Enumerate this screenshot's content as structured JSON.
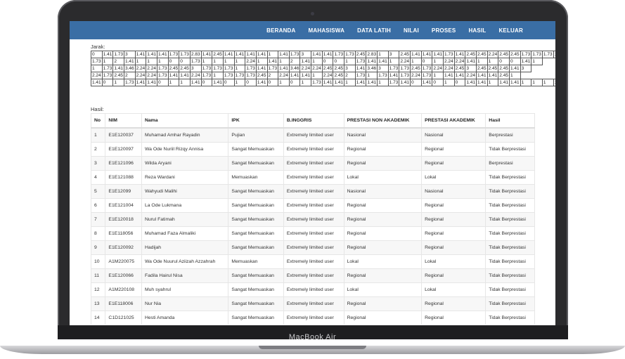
{
  "device": {
    "brand_label": "MacBook Air"
  },
  "nav": {
    "items": [
      "BERANDA",
      "MAHASISWA",
      "DATA LATIH",
      "NILAI",
      "PROSES",
      "HASIL",
      "KELUAR"
    ]
  },
  "jarak": {
    "label": "Jarak:",
    "rows": [
      [
        "0",
        "1.41",
        "1.73",
        "3",
        "1.41",
        "1.41",
        "1.41",
        "1.73",
        "1.73",
        "2.83",
        "1.41",
        "2.45",
        "1.41",
        "1.41",
        "1.41",
        "1.41",
        "1",
        "1.41",
        "1.73",
        "3",
        "1.41",
        "1.41",
        "1.73",
        "1.73",
        "2.45",
        "2.83",
        "1",
        "3",
        "2.45",
        "1.41",
        "1.41",
        "1.41",
        "1.73",
        "1.41",
        "2.45",
        "2.45",
        "2.24",
        "2.45",
        "2.45",
        "1.73",
        "1.73",
        "1.73",
        "1",
        "2"
      ],
      [
        "1.73",
        "1",
        "2",
        "1.41",
        "1",
        "1",
        "1",
        "0",
        "0",
        "1.73",
        "1",
        "1",
        "1",
        "1",
        "2.24",
        "1",
        "1.41",
        "1",
        "2",
        "1.41",
        "1",
        "0",
        "0",
        "1",
        "1.73",
        "1.41",
        "1.41",
        "1",
        "2.24",
        "1",
        "0",
        "1",
        "2.24",
        "2.24",
        "1.41",
        "1",
        "1",
        "0",
        "0",
        "1.41",
        "1"
      ],
      [
        "1",
        "1.73",
        "1.41",
        "3.46",
        "2.24",
        "2.24",
        "1.73",
        "2.45",
        "2.45",
        "3",
        "1.73",
        "1.73",
        "1.73",
        "1",
        "1.73",
        "1.41",
        "1.73",
        "1.41",
        "3.46",
        "2.24",
        "2.24",
        "2.45",
        "2.45",
        "3",
        "1.41",
        "3.46",
        "3",
        "1.73",
        "1.73",
        "2.45",
        "1.73",
        "2.24",
        "2.24",
        "2.45",
        "3",
        "2.45",
        "2.45",
        "2.45",
        "1.41",
        "3"
      ],
      [
        "2.24",
        "1.73",
        "2.45",
        "2",
        "2.24",
        "2.24",
        "1.73",
        "1.41",
        "1.41",
        "2.24",
        "1.73",
        "1",
        "1.73",
        "1.73",
        "1.73",
        "2.45",
        "2",
        "2.24",
        "1.41",
        "1.41",
        "1",
        "2.24",
        "2.45",
        "2",
        "1.73",
        "1",
        "1.73",
        "1.41",
        "1.73",
        "2.24",
        "1.73",
        "1",
        "1.41",
        "1.41",
        "2.24",
        "1.41",
        "1.41",
        "2.45",
        "1"
      ],
      [
        "1.41",
        "0",
        "1",
        "1.73",
        "1.41",
        "1.41",
        "0",
        "1",
        "1",
        "1.41",
        "0",
        "1.41",
        "0",
        "1",
        "0",
        "1.41",
        "0",
        "1",
        "0",
        "1",
        "1.73",
        "1.41",
        "1.41",
        "1",
        "1.41",
        "1.41",
        "1",
        "1.73",
        "1.41",
        "0",
        "1.41",
        "0",
        "1",
        "0",
        "1.41",
        "1.41",
        "1",
        "1.41",
        "1.41",
        "1",
        "1",
        "1",
        "1",
        "1"
      ]
    ]
  },
  "hasil": {
    "label": "Hasil:",
    "headers": [
      "No",
      "NIM",
      "Nama",
      "IPK",
      "B.INGGRIS",
      "PRESTASI NON AKADEMIK",
      "PRESTASI AKADEMIK",
      "Hasil"
    ],
    "rows": [
      [
        "1",
        "E1E120037",
        "Muhamad Amhar Rayadin",
        "Pujian",
        "Extremely limited user",
        "Nasional",
        "Nasional",
        "Berprestasi"
      ],
      [
        "2",
        "E1E120097",
        "Wa Ode Nuriil Rizqy Annisa",
        "Sangat Memuaskan",
        "Extremely limited user",
        "Regional",
        "Regional",
        "Tidak Berprestasi"
      ],
      [
        "3",
        "E1E121096",
        "Wilda Aryani",
        "Sangat Memuaskan",
        "Extremely limited user",
        "Regional",
        "Regional",
        "Berprestasi"
      ],
      [
        "4",
        "E1E121088",
        "Reza Wardani",
        "Memuaskan",
        "Extremely limited user",
        "Lokal",
        "Lokal",
        "Tidak Berprestasi"
      ],
      [
        "5",
        "E1E12099",
        "Wahyudi Malihi",
        "Sangat Memuaskan",
        "Extremely limited user",
        "Nasional",
        "Nasional",
        "Tidak Berprestasi"
      ],
      [
        "6",
        "E1E121004",
        "La Ode Lukmana",
        "Sangat Memuaskan",
        "Extremely limited user",
        "Regional",
        "Regional",
        "Tidak Berprestasi"
      ],
      [
        "7",
        "E1E120018",
        "Nurul Fatimah",
        "Sangat Memuaskan",
        "Extremely limited user",
        "Regional",
        "Regional",
        "Tidak Berprestasi"
      ],
      [
        "8",
        "E1E118056",
        "Muhamad Faza Almaliki",
        "Sangat Memuaskan",
        "Extremely limited user",
        "Regional",
        "Regional",
        "Tidak Berprestasi"
      ],
      [
        "9",
        "E1E120092",
        "Hadijah",
        "Sangat Memuaskan",
        "Extremely limited user",
        "Regional",
        "Regional",
        "Tidak Berprestasi"
      ],
      [
        "10",
        "A1M220075",
        "Wa Ode Nuurul Aziizah Azzahrah",
        "Memuaskan",
        "Extremely limited user",
        "Lokal",
        "Lokal",
        "Tidak Berprestasi"
      ],
      [
        "11",
        "E1E120066",
        "Fadila Hairul Nisa",
        "Sangat Memuaskan",
        "Extremely limited user",
        "Regional",
        "Regional",
        "Tidak Berprestasi"
      ],
      [
        "12",
        "A1M220108",
        "Muh syahrul",
        "Sangat Memuaskan",
        "Extremely limited user",
        "Lokal",
        "Lokal",
        "Tidak Berprestasi"
      ],
      [
        "13",
        "E1E118006",
        "Nur Nia",
        "Sangat Memuaskan",
        "Extremely limited user",
        "Regional",
        "Regional",
        "Tidak Berprestasi"
      ],
      [
        "14",
        "C1D121025",
        "Hesti Amanda",
        "Sangat Memuaskan",
        "Extremely limited user",
        "Regional",
        "Regional",
        "Tidak Berprestasi"
      ]
    ]
  }
}
